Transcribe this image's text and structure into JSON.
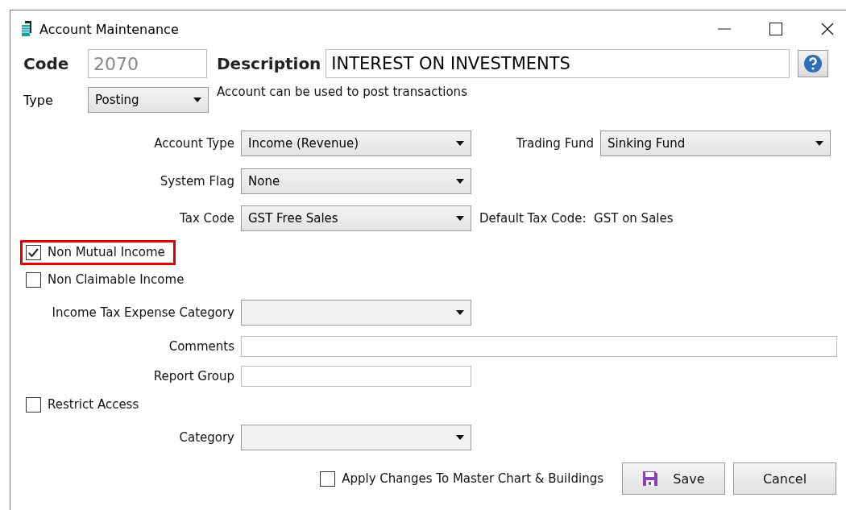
{
  "window": {
    "title": "Account Maintenance"
  },
  "code": {
    "label": "Code",
    "value": "2070",
    "disabled": true
  },
  "description": {
    "label": "Description",
    "value": "INTEREST ON INVESTMENTS"
  },
  "type": {
    "label": "Type",
    "value": "Posting",
    "note": "Account can be used to post transactions"
  },
  "account_type": {
    "label": "Account Type",
    "value": "Income (Revenue)"
  },
  "trading_fund": {
    "label": "Trading Fund",
    "value": "Sinking Fund"
  },
  "system_flag": {
    "label": "System Flag",
    "value": "None"
  },
  "tax_code": {
    "label": "Tax Code",
    "value": "GST Free Sales",
    "note": "Default Tax Code:  GST on Sales"
  },
  "flags": [
    {
      "label": "Non Mutual Income",
      "checked": true,
      "highlighted": true
    },
    {
      "label": "Non Claimable Income",
      "checked": false,
      "highlighted": false
    }
  ],
  "income_tax_expense_category": {
    "label": "Income Tax Expense Category"
  },
  "comments": {
    "label": "Comments"
  },
  "report_group": {
    "label": "Report Group"
  },
  "restrict_access": {
    "label": "Restrict Access",
    "checked": false
  },
  "category": {
    "label": "Category"
  },
  "apply_changes": {
    "label": "Apply Changes To Master Chart & Buildings",
    "checked": false
  },
  "buttons": [
    {
      "kind": "save",
      "label": "Save"
    },
    {
      "kind": "cancel",
      "label": "Cancel"
    }
  ]
}
